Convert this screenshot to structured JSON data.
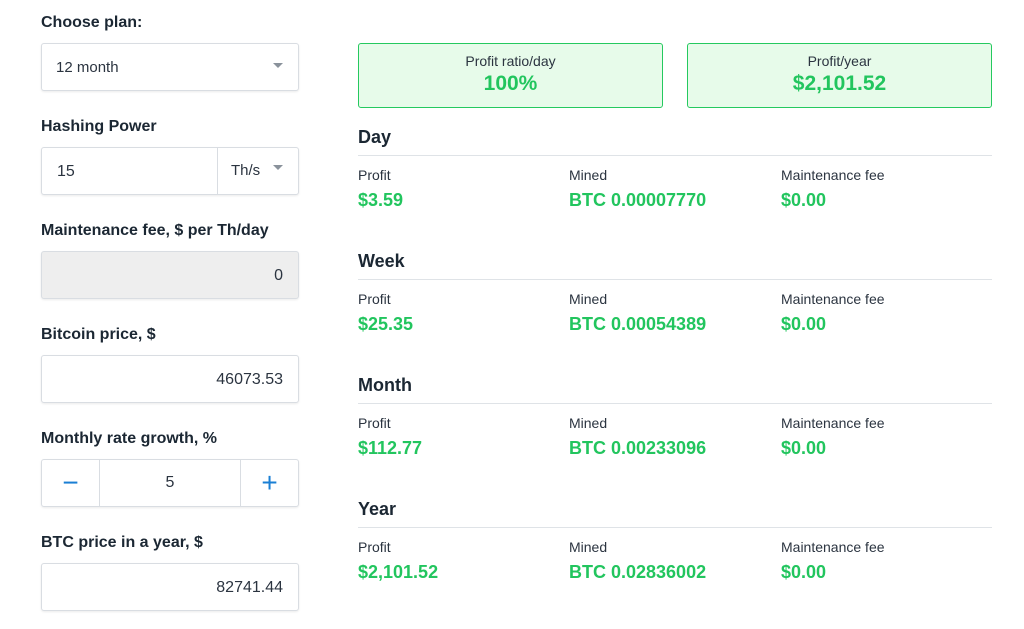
{
  "plan": {
    "label": "Choose plan:",
    "value": "12 month"
  },
  "hashing": {
    "label": "Hashing Power",
    "value": "15",
    "unit": "Th/s"
  },
  "maintenance": {
    "label": "Maintenance fee, $ per Th/day",
    "value": "0"
  },
  "btc_price": {
    "label": "Bitcoin price, $",
    "value": "46073.53"
  },
  "growth": {
    "label": "Monthly rate growth, %",
    "value": "5",
    "minus": "−",
    "plus": "+"
  },
  "btc_year": {
    "label": "BTC price in a year, $",
    "value": "82741.44"
  },
  "cards": {
    "ratio": {
      "label": "Profit ratio/day",
      "value": "100%"
    },
    "year": {
      "label": "Profit/year",
      "value": "$2,101.52"
    }
  },
  "columns": {
    "profit": "Profit",
    "mined": "Mined",
    "fee": "Maintenance fee"
  },
  "periods": [
    {
      "title": "Day",
      "profit": "$3.59",
      "mined": "BTC 0.00007770",
      "fee": "$0.00"
    },
    {
      "title": "Week",
      "profit": "$25.35",
      "mined": "BTC 0.00054389",
      "fee": "$0.00"
    },
    {
      "title": "Month",
      "profit": "$112.77",
      "mined": "BTC 0.00233096",
      "fee": "$0.00"
    },
    {
      "title": "Year",
      "profit": "$2,101.52",
      "mined": "BTC 0.02836002",
      "fee": "$0.00"
    }
  ],
  "colors": {
    "accent_green": "#22c55e",
    "card_bg": "#e7fbea",
    "stepper_blue": "#1a7fd4"
  }
}
